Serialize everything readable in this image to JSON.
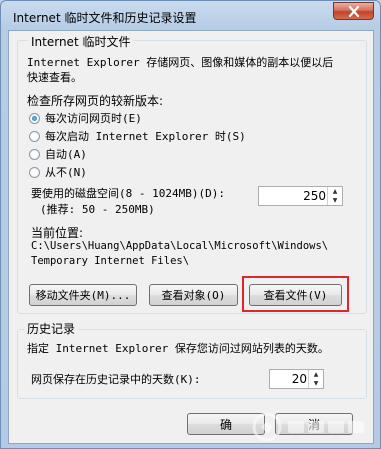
{
  "window": {
    "title": "Internet 临时文件和历史记录设置"
  },
  "temp_files": {
    "group_title": "Internet 临时文件",
    "description_line1": "Internet Explorer 存储网页、图像和媒体的副本以便以后",
    "description_line2": "快速查看。",
    "check_label": "检查所存网页的较新版本:",
    "options": [
      {
        "label": "每次访问网页时(E)",
        "selected": true
      },
      {
        "label": "每次启动 Internet Explorer 时(S)",
        "selected": false
      },
      {
        "label": "自动(A)",
        "selected": false
      },
      {
        "label": "从不(N)",
        "selected": false
      }
    ],
    "disk_label_line1": "要使用的磁盘空间(8 - 1024MB)(D):",
    "disk_label_line2": "(推荐: 50 - 250MB)",
    "disk_value": "250",
    "location_label": "当前位置:",
    "location_line1": "C:\\Users\\Huang\\AppData\\Local\\Microsoft\\Windows\\",
    "location_line2": "Temporary Internet Files\\",
    "buttons": {
      "move_folder": "移动文件夹(M)...",
      "view_objects": "查看对象(O)",
      "view_files": "查看文件(V)"
    }
  },
  "history": {
    "group_title": "历史记录",
    "description": "指定 Internet Explorer 保存您访问过网站列表的天数。",
    "days_label": "网页保存在历史记录中的天数(K):",
    "days_value": "20"
  },
  "footer": {
    "ok_partial": "确",
    "cancel_partial": "消"
  },
  "colors": {
    "highlight": "#e0262d",
    "close_button": "#c1442b"
  }
}
